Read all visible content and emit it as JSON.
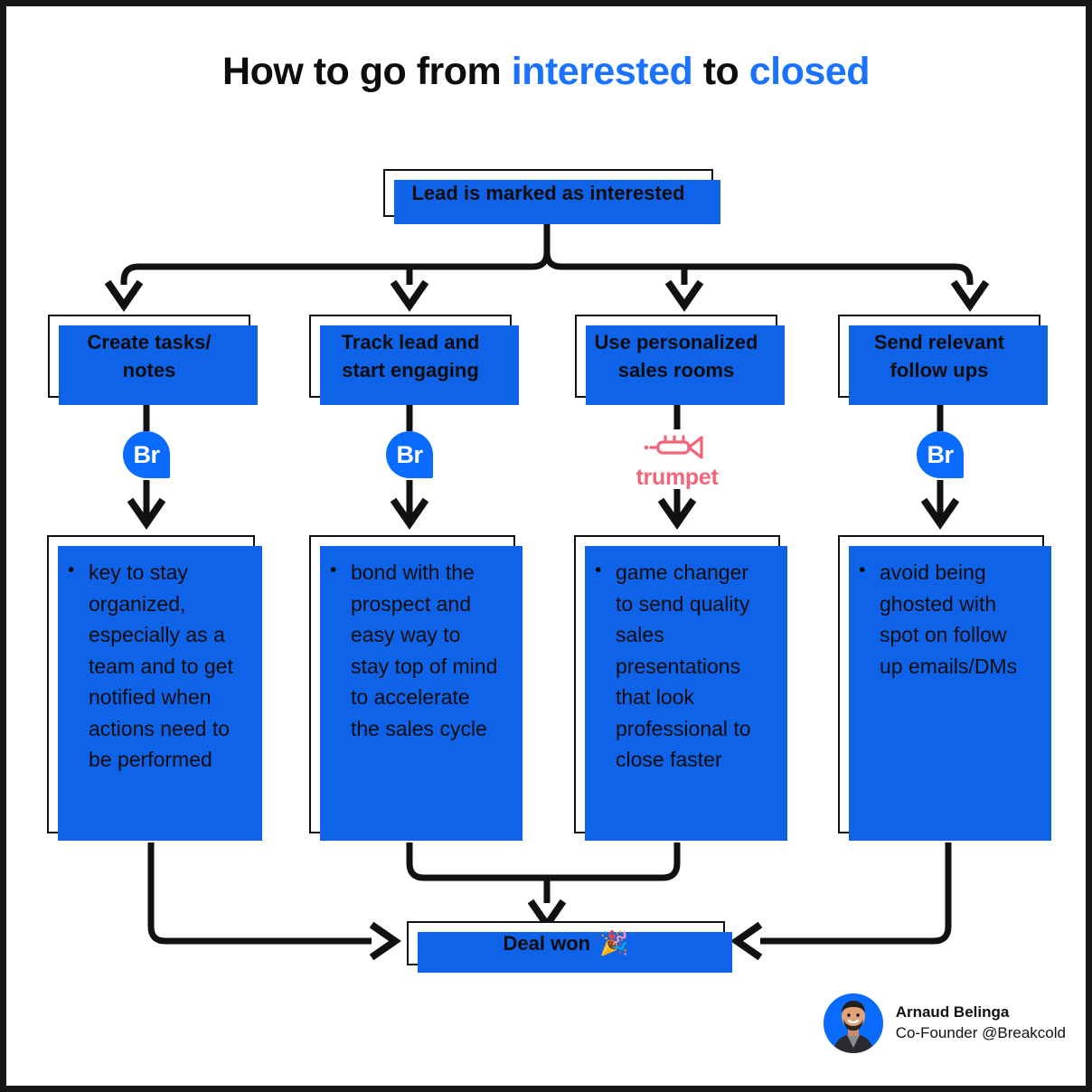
{
  "title": {
    "part1": "How to go from ",
    "accent1": "interested",
    "part2": " to ",
    "accent2": "closed"
  },
  "colors": {
    "accent_blue": "#1a73ff",
    "shadow_blue": "#0f63e8",
    "badge_blue": "#0a6bff",
    "trumpet_pink": "#f4647a",
    "ink": "#0d0d0d",
    "frame": "#161616"
  },
  "top_node": {
    "label": "Lead is marked as interested"
  },
  "columns": [
    {
      "step": "Create tasks/ notes",
      "step_line1": "Create tasks/",
      "step_line2": "notes",
      "logo": {
        "type": "breakcold-badge",
        "label": "Br"
      },
      "bullets": [
        "key to stay organized, especially as a team and to get notified when actions need to be performed"
      ]
    },
    {
      "step": "Track lead and start engaging",
      "step_line1": "Track lead and",
      "step_line2": "start engaging",
      "logo": {
        "type": "breakcold-badge",
        "label": "Br"
      },
      "bullets": [
        "bond with the prospect and easy way to stay top of mind to accelerate the sales cycle"
      ]
    },
    {
      "step": "Use personalized sales rooms",
      "step_line1": "Use personalized",
      "step_line2": "sales rooms",
      "logo": {
        "type": "trumpet-logo",
        "label": "trumpet"
      },
      "bullets": [
        "game changer to send quality sales presentations that look professional to close faster"
      ]
    },
    {
      "step": "Send relevant follow ups",
      "step_line1": "Send relevant",
      "step_line2": "follow ups",
      "logo": {
        "type": "breakcold-badge",
        "label": "Br"
      },
      "bullets": [
        "avoid being ghosted with spot on follow up emails/DMs"
      ]
    }
  ],
  "deal_node": {
    "label": "Deal won",
    "emoji": "🎉"
  },
  "credit": {
    "name": "Arnaud Belinga",
    "role": "Co-Founder @Breakcold"
  }
}
